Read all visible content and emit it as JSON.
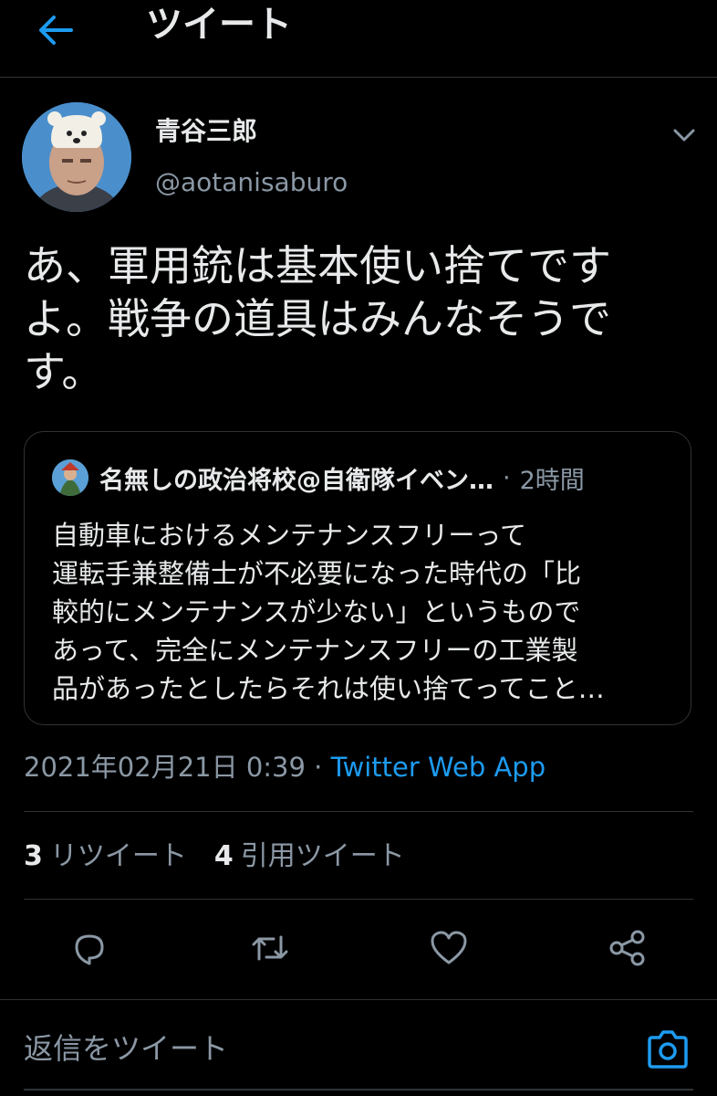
{
  "header": {
    "title": "ツイート",
    "back_icon": "arrow-left-icon"
  },
  "tweet": {
    "author_name": "青谷三郎",
    "author_handle": "@aotanisaburo",
    "text": "あ、軍用銃は基本使い捨てです\nよ。戦争の道具はみんなそうで\nす。",
    "timestamp": "2021年02月21日 0:39",
    "separator": "·",
    "source": "Twitter Web App"
  },
  "quote": {
    "author_name": "名無しの政治将校@自衛隊イベン…",
    "separator": "·",
    "time": "2時間",
    "text": "自動車におけるメンテナンスフリーって\n運転手兼整備士が不必要になった時代の「比\n較的にメンテナンスが少ない」というもので\nあって、完全にメンテナンスフリーの工業製\n品があったとしたらそれは使い捨てってこと…"
  },
  "stats": {
    "retweets_count": "3",
    "retweets_label": "リツイート",
    "quotes_count": "4",
    "quotes_label": "引用ツイート"
  },
  "actions": [
    "reply-icon",
    "retweet-icon",
    "like-icon",
    "share-icon"
  ],
  "reply": {
    "placeholder": "返信をツイート",
    "camera_icon": "camera-icon"
  },
  "colors": {
    "background": "#000000",
    "accent": "#1d9bf0",
    "text": "#e7e9ea",
    "muted": "#8b98a5",
    "border": "#2f3336"
  }
}
